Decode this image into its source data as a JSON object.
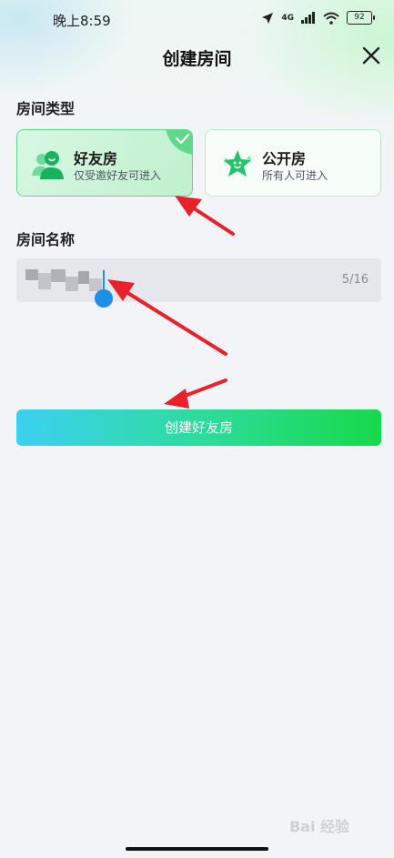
{
  "status_bar": {
    "time": "晚上8:59",
    "network": "4G",
    "battery_level": "92"
  },
  "header": {
    "title": "创建房间",
    "close_icon": "close-icon"
  },
  "room_type": {
    "label": "房间类型",
    "options": [
      {
        "title": "好友房",
        "subtitle": "仅受邀好友可进入",
        "icon": "friends-icon",
        "selected": true
      },
      {
        "title": "公开房",
        "subtitle": "所有人可进入",
        "icon": "star-face-icon",
        "selected": false
      }
    ]
  },
  "room_name": {
    "label": "房间名称",
    "counter": "5/16"
  },
  "create_button": {
    "label": "创建好友房"
  },
  "watermark": "Bai 经验",
  "colors": {
    "accent_green": "#16d94a",
    "accent_cyan": "#3cd0f2",
    "annotation_red": "#e8212a",
    "cursor_blue": "#1f8ee6"
  }
}
